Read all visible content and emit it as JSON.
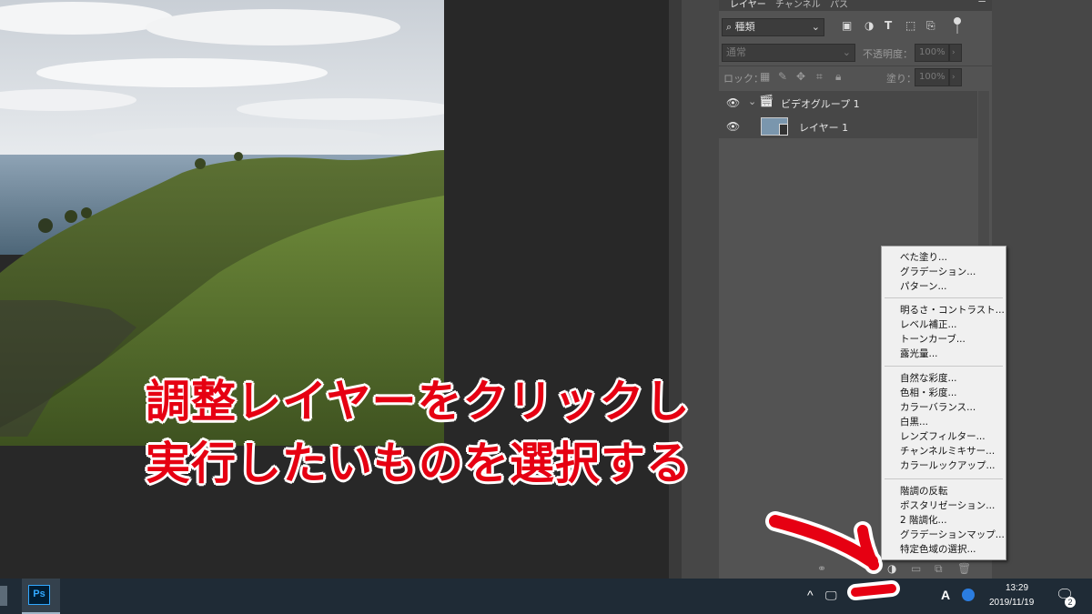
{
  "colors": {
    "accent_red": "#e60012",
    "menu_bg": "#f0f0f0",
    "panel_bg": "#535353",
    "taskbar_bg": "#1f2b36"
  },
  "layers_panel": {
    "tabs": [
      "レイヤー",
      "チャンネル",
      "パス"
    ],
    "filter": {
      "value": "種類"
    },
    "blend_mode": "通常",
    "opacity_label": "不透明度：",
    "opacity_value": "100%",
    "lock_label": "ロック：",
    "fill_label": "塗り：",
    "fill_value": "100%",
    "layers": [
      {
        "name": "ビデオグループ 1",
        "type": "video-group",
        "visible": true
      },
      {
        "name": "レイヤー 1",
        "type": "layer",
        "visible": true
      }
    ]
  },
  "adjustment_menu": {
    "groups": [
      [
        "べた塗り...",
        "グラデーション...",
        "パターン..."
      ],
      [
        "明るさ・コントラスト...",
        "レベル補正...",
        "トーンカーブ...",
        "露光量..."
      ],
      [
        "自然な彩度...",
        "色相・彩度...",
        "カラーバランス...",
        "白黒...",
        "レンズフィルター...",
        "チャンネルミキサー...",
        "カラールックアップ..."
      ],
      [
        "階調の反転",
        "ポスタリゼーション...",
        "2 階調化...",
        "グラデーションマップ...",
        "特定色域の選択..."
      ]
    ]
  },
  "caption": {
    "line1": "調整レイヤーをクリックし",
    "line2": "実行したいものを選択する"
  },
  "taskbar": {
    "time": "13:29",
    "date": "2019/11/19",
    "ime": "A",
    "notification_count": "2",
    "ps_label": "Ps"
  }
}
